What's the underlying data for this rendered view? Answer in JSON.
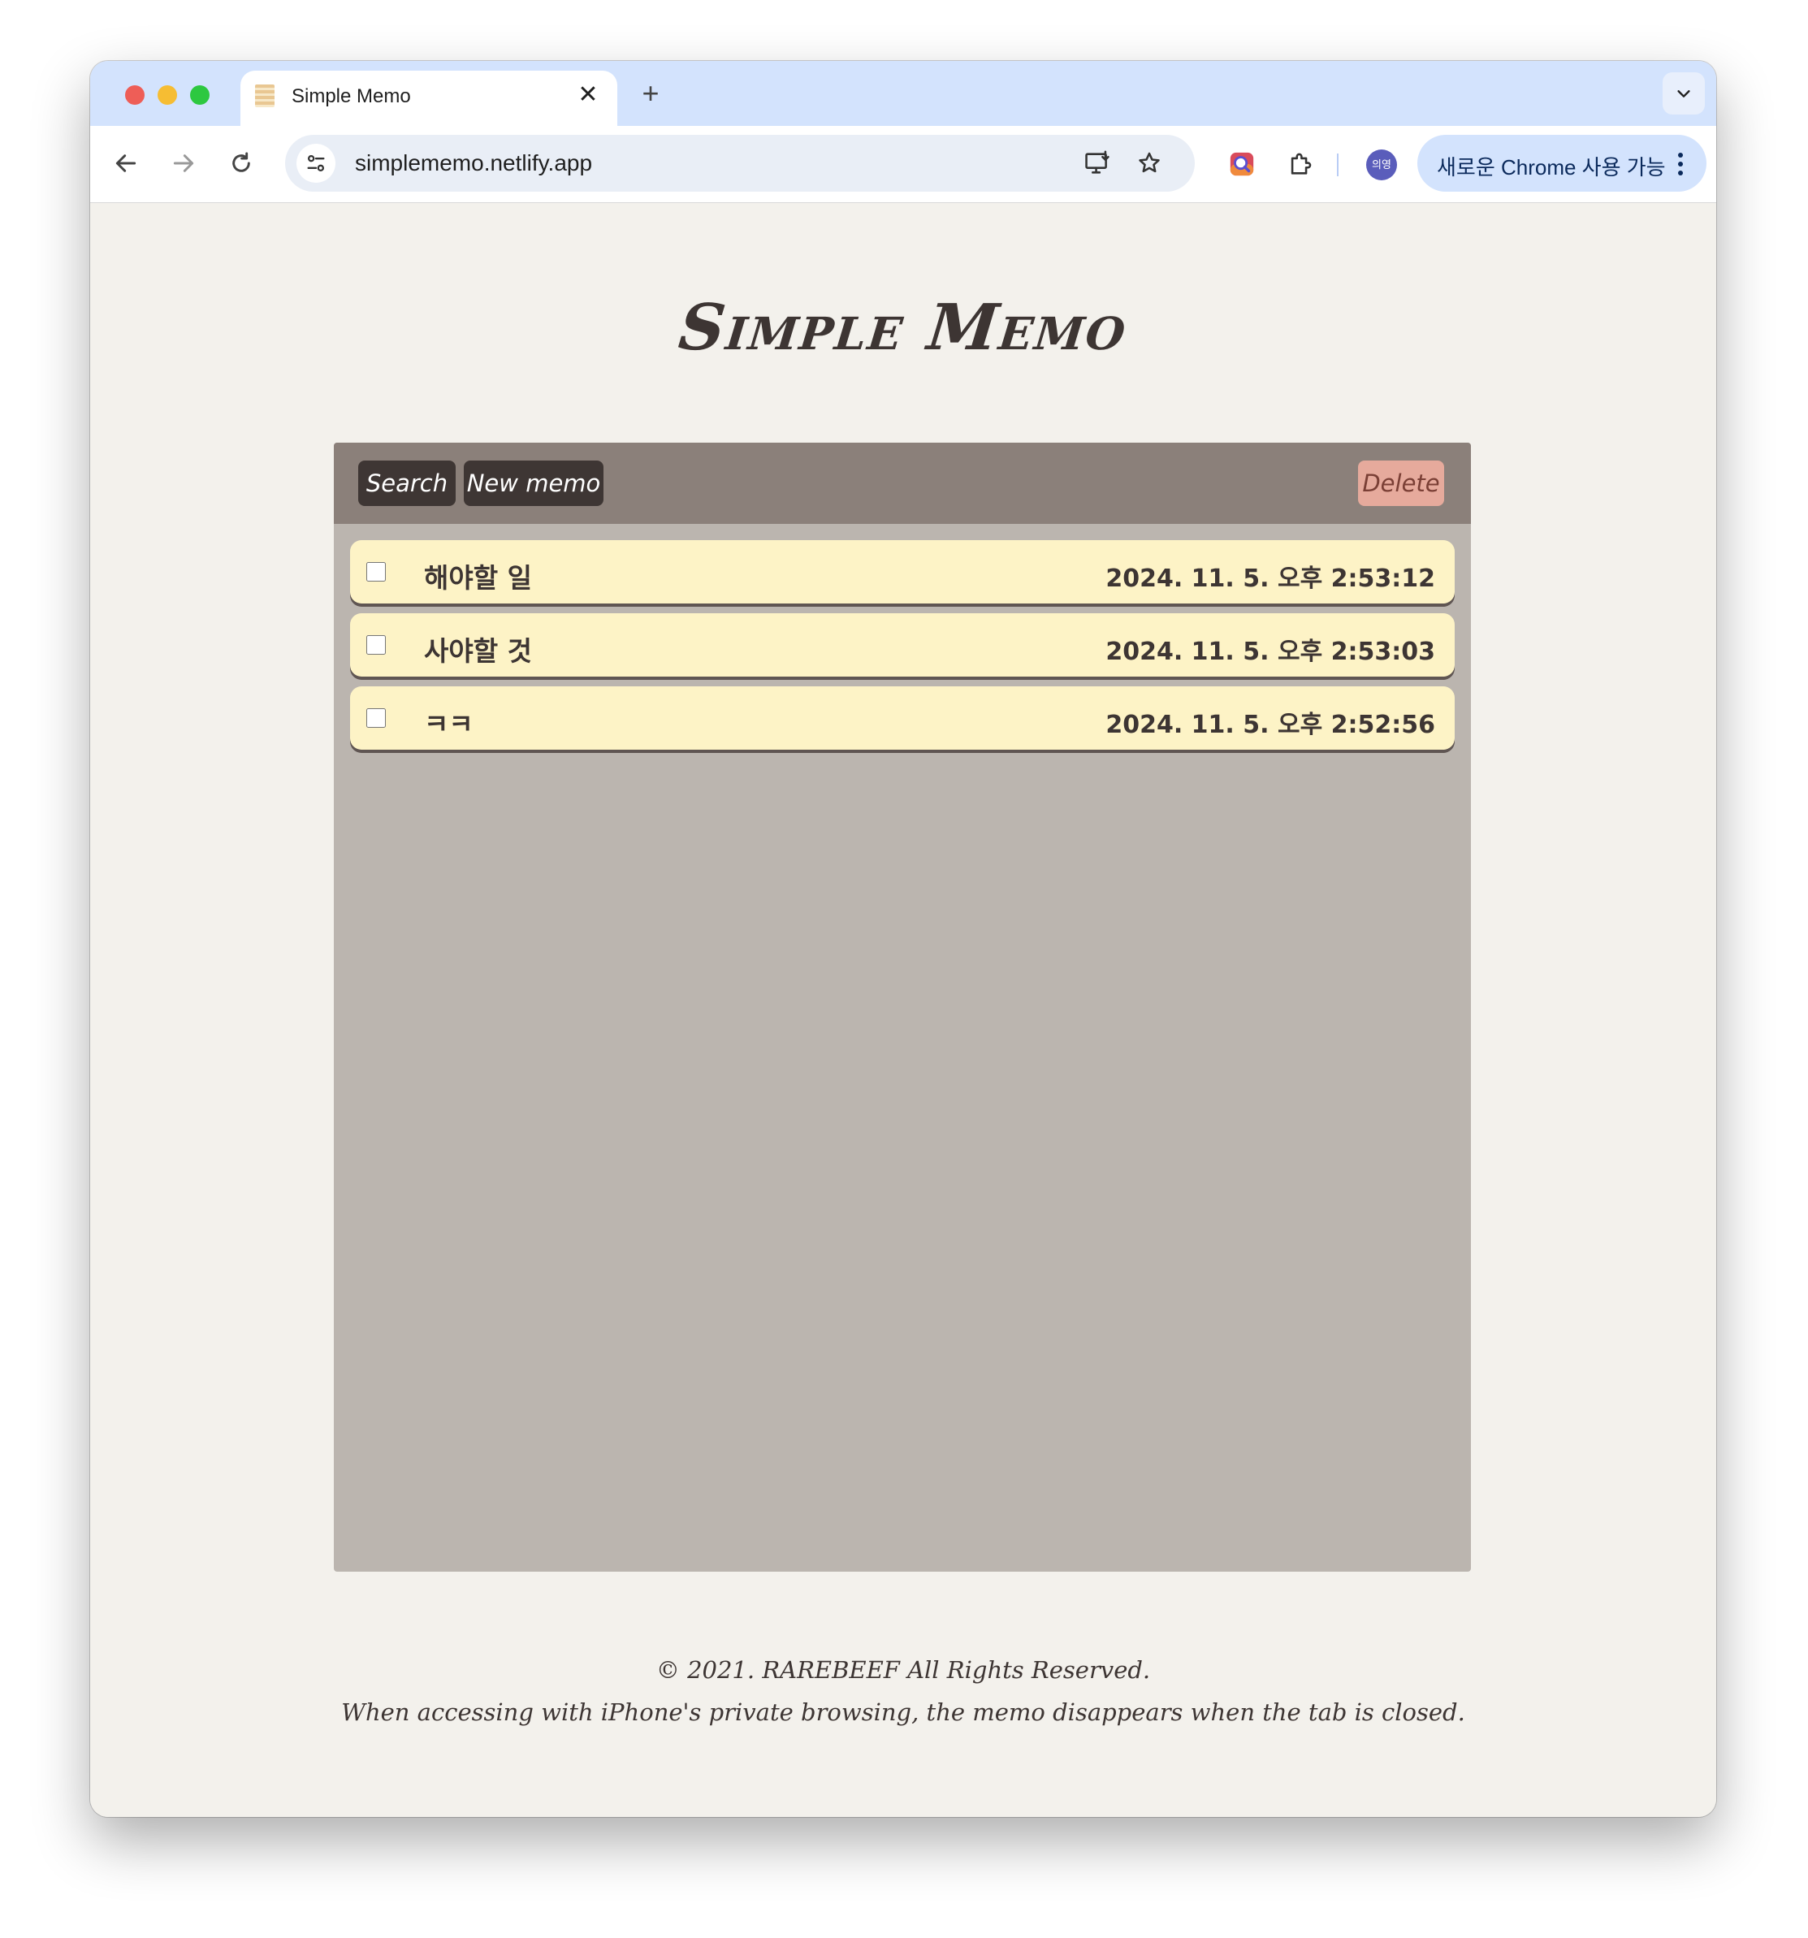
{
  "browser": {
    "tab_title": "Simple Memo",
    "tab_close_glyph": "✕",
    "new_tab_glyph": "+",
    "url": "simplememo.netlify.app",
    "profile_initials": "의영",
    "update_label": "새로운 Chrome 사용 가능",
    "icons": [
      "back-arrow-icon",
      "forward-arrow-icon",
      "reload-icon",
      "site-settings-icon",
      "install-app-icon",
      "bookmark-star-icon",
      "search-extension-icon",
      "extensions-puzzle-icon",
      "more-vert-icon"
    ]
  },
  "app": {
    "title": "Simple Memo",
    "buttons": {
      "search": "Search",
      "new_memo": "New memo",
      "delete": "Delete"
    },
    "memos": [
      {
        "title": "해야할 일",
        "date": "2024. 11. 5. 오후 2:53:12",
        "checked": false
      },
      {
        "title": "사야할 것",
        "date": "2024. 11. 5. 오후 2:53:03",
        "checked": false
      },
      {
        "title": "ㅋㅋ",
        "date": "2024. 11. 5. 오후 2:52:56",
        "checked": false
      }
    ],
    "footer": {
      "copyright": "© 2021. RAREBEEF All Rights Reserved.",
      "note": "When accessing with iPhone's private browsing, the memo disappears when the tab is closed."
    }
  },
  "colors": {
    "page_bg": "#f3f1ec",
    "panel_bg": "#bbb5af",
    "header_bg": "#8b807a",
    "button_dark": "#3e3634",
    "delete_button": "#e6aa9c",
    "memo_bg": "#fdf3c6",
    "text_dark": "#3d3533"
  }
}
